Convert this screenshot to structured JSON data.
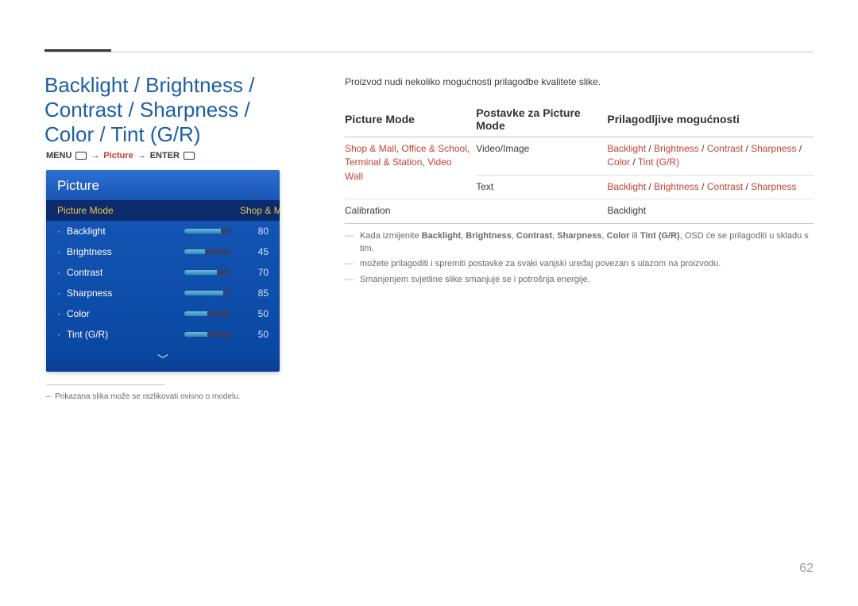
{
  "page_number": "62",
  "title": "Backlight / Brightness / Contrast / Sharpness / Color / Tint (G/R)",
  "breadcrumb": {
    "menu": "MENU",
    "picture": "Picture",
    "enter": "ENTER"
  },
  "panel": {
    "header": "Picture",
    "selected": {
      "label": "Picture Mode",
      "value": "Shop & Mall"
    },
    "rows": [
      {
        "label": "Backlight",
        "value": "80",
        "pct": 80
      },
      {
        "label": "Brightness",
        "value": "45",
        "pct": 45
      },
      {
        "label": "Contrast",
        "value": "70",
        "pct": 70
      },
      {
        "label": "Sharpness",
        "value": "85",
        "pct": 85
      },
      {
        "label": "Color",
        "value": "50",
        "pct": 50
      },
      {
        "label": "Tint (G/R)",
        "value": "50",
        "pct": 50
      }
    ]
  },
  "footnote_prefix": "–",
  "footnote": "Prikazana slika može se razlikovati ovisno o modelu.",
  "intro": "Proizvod nudi nekoliko mogućnosti prilagodbe kvalitete slike.",
  "table": {
    "headers": [
      "Picture Mode",
      "Postavke za Picture Mode",
      "Prilagodljive mogućnosti"
    ]
  },
  "row1": {
    "modes_a": "Shop & Mall",
    "modes_b": "Office & School",
    "modes_c": "Terminal & Station",
    "modes_d": "Video Wall",
    "sep": ", ",
    "setting": "Video/Image",
    "adj_a": "Backlight",
    "adj_b": "Brightness",
    "adj_c": "Contrast",
    "adj_d": "Sharpness",
    "adj_e": "Color",
    "adj_f": "Tint (G/R)",
    "slash": " / "
  },
  "row2": {
    "setting": "Text",
    "adj_a": "Backlight",
    "adj_b": "Brightness",
    "adj_c": "Contrast",
    "adj_d": "Sharpness",
    "slash": " / "
  },
  "row3": {
    "mode": "Calibration",
    "adj": "Backlight"
  },
  "notes": {
    "n1_a": "Kada izmijenite ",
    "n1_b1": "Backlight",
    "n1_b2": "Brightness",
    "n1_b3": "Contrast",
    "n1_b4": "Sharpness",
    "n1_b5": "Color",
    "n1_mid": " ili ",
    "n1_b6": "Tint (G/R)",
    "n1_c": ", OSD će se prilagoditi u skladu s tim.",
    "n1_sep": ", ",
    "n2": "možete prilagoditi i spremiti postavke za svaki vanjski uređaj povezan s ulazom na proizvodu.",
    "n3": "Smanjenjem svjetline slike smanjuje se i potrošnja energije."
  }
}
